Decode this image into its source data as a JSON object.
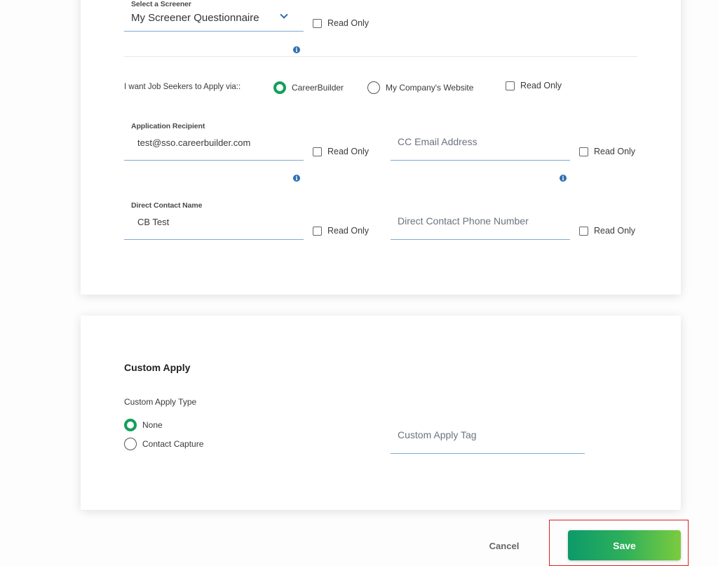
{
  "screener": {
    "label": "Select a Screener",
    "value": "My Screener Questionnaire",
    "read_only_label": "Read Only",
    "read_only_checked": false
  },
  "apply_via": {
    "label": "I want Job Seekers to Apply via::",
    "options": [
      {
        "label": "CareerBuilder",
        "checked": true
      },
      {
        "label": "My Company's Website",
        "checked": false
      }
    ],
    "read_only_label": "Read Only",
    "read_only_checked": false
  },
  "application_recipient": {
    "label": "Application Recipient",
    "value": "test@sso.careerbuilder.com",
    "read_only_label": "Read Only"
  },
  "cc_email": {
    "placeholder": "CC Email Address",
    "value": "",
    "read_only_label": "Read Only"
  },
  "direct_contact_name": {
    "label": "Direct Contact Name",
    "value": "CB Test",
    "read_only_label": "Read Only"
  },
  "direct_contact_phone": {
    "placeholder": "Direct Contact Phone Number",
    "value": "",
    "read_only_label": "Read Only"
  },
  "custom_apply": {
    "title": "Custom Apply",
    "type_label": "Custom Apply Type",
    "options": [
      {
        "label": "None",
        "checked": true
      },
      {
        "label": "Contact Capture",
        "checked": false
      }
    ],
    "tag_placeholder": "Custom Apply Tag",
    "tag_value": ""
  },
  "footer": {
    "cancel_label": "Cancel",
    "save_label": "Save"
  },
  "colors": {
    "accent_green": "#12a05a",
    "info_blue": "#2d6fb0",
    "underline_blue": "#7fa9d3",
    "highlight_red": "#e02020"
  }
}
